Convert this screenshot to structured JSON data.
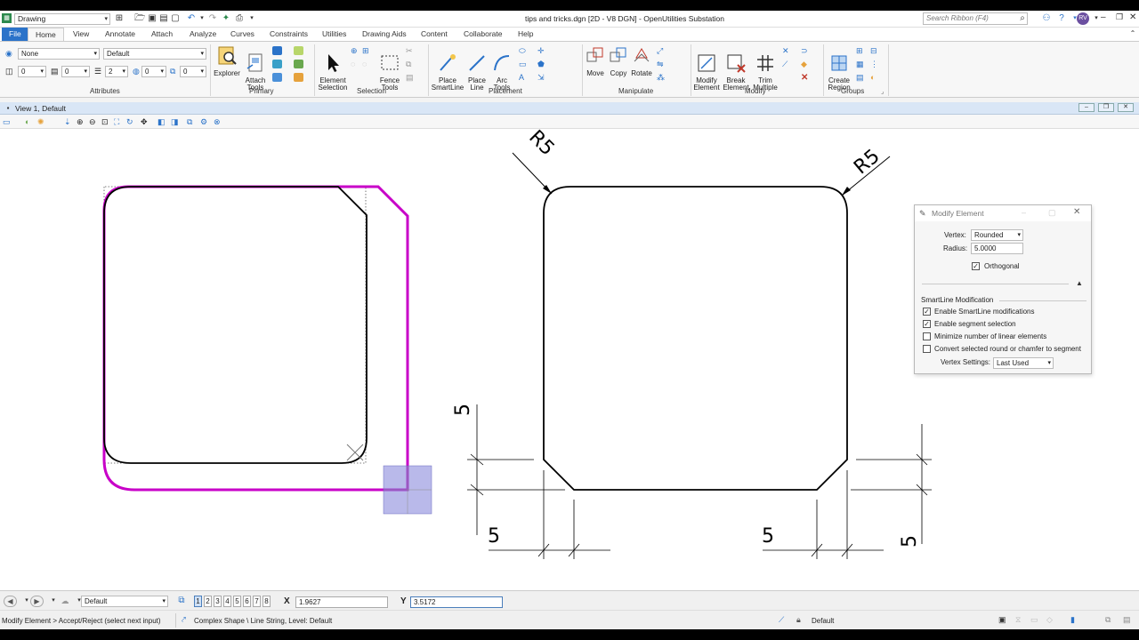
{
  "titlebar": {
    "workspace": "Drawing",
    "window_title": "tips and tricks.dgn [2D - V8 DGN] - OpenUtilities Substation",
    "search_placeholder": "Search Ribbon (F4)",
    "user_initials": "RV"
  },
  "tabs": [
    "File",
    "Home",
    "View",
    "Annotate",
    "Attach",
    "Analyze",
    "Curves",
    "Constraints",
    "Utilities",
    "Drawing Aids",
    "Content",
    "Collaborate",
    "Help"
  ],
  "active_tab": "Home",
  "ribbon": {
    "attributes": {
      "level": "None",
      "style": "Default",
      "color": "0",
      "weight_value": "0",
      "line_style": "2",
      "transparency": "0",
      "priority": "0",
      "extra": "0",
      "label": "Attributes"
    },
    "primary": {
      "explorer": "Explorer",
      "attach_tools": "Attach\nTools",
      "label": "Primary"
    },
    "selection": {
      "element_selection": "Element\nSelection",
      "fence_tools": "Fence\nTools",
      "label": "Selection"
    },
    "placement": {
      "place_smartline": "Place\nSmartLine",
      "place_line": "Place\nLine",
      "arc_tools": "Arc\nTools",
      "label": "Placement"
    },
    "manipulate": {
      "move": "Move",
      "copy": "Copy",
      "rotate": "Rotate",
      "label": "Manipulate"
    },
    "modify": {
      "modify_element": "Modify\nElement",
      "break_element": "Break\nElement",
      "trim_multiple": "Trim\nMultiple",
      "label": "Modify"
    },
    "groups": {
      "create_region": "Create\nRegion",
      "label": "Groups"
    }
  },
  "view": {
    "title": "View 1, Default"
  },
  "drawing": {
    "radius_left": "R5",
    "radius_right": "R5",
    "dims": [
      "5",
      "5",
      "5",
      "5"
    ]
  },
  "dialog": {
    "title": "Modify Element",
    "vertex_label": "Vertex:",
    "vertex_value": "Rounded",
    "radius_label": "Radius:",
    "radius_value": "5.0000",
    "orthogonal_label": "Orthogonal",
    "orthogonal_checked": true,
    "section_title": "SmartLine Modification",
    "options": [
      {
        "label": "Enable SmartLine modifications",
        "checked": true
      },
      {
        "label": "Enable segment selection",
        "checked": true
      },
      {
        "label": "Minimize number of linear elements",
        "checked": false
      },
      {
        "label": "Convert selected round or chamfer to segment",
        "checked": false
      }
    ],
    "vertex_settings_label": "Vertex Settings:",
    "vertex_settings_value": "Last Used"
  },
  "status": {
    "view_group": "Default",
    "view_numbers": [
      "1",
      "2",
      "3",
      "4",
      "5",
      "6",
      "7",
      "8"
    ],
    "x_label": "X",
    "x_value": "1.9627",
    "y_label": "Y",
    "y_value": "3.5172",
    "prompt": "Modify Element > Accept/Reject (select next input)",
    "element_info": "Complex Shape \\ Line String, Level: Default",
    "active_model": "Default"
  },
  "colors": {
    "file_tab": "#2b73c9",
    "highlight": "#c800c8",
    "view_bar": "#d9e6f6"
  }
}
